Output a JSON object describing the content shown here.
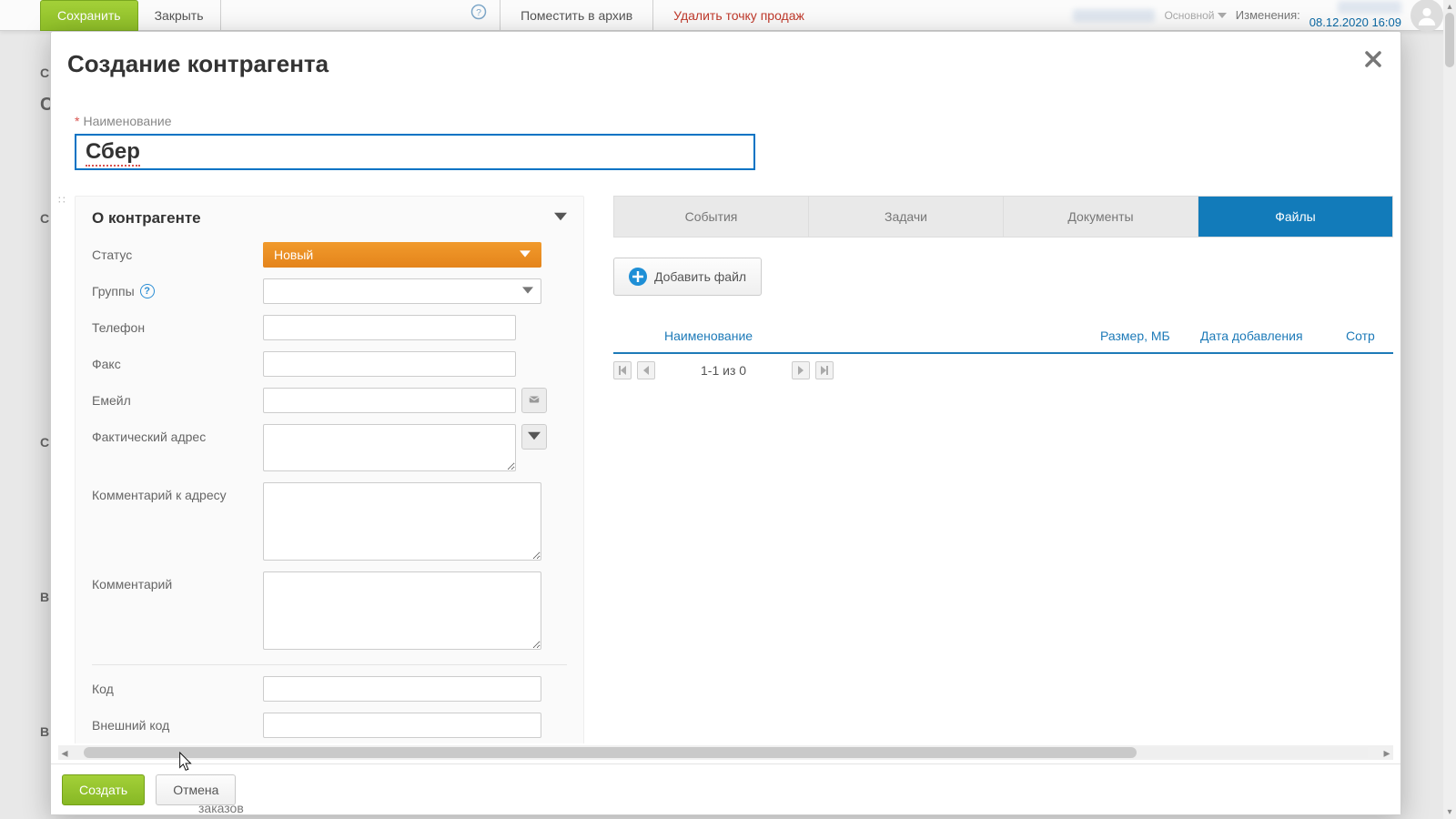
{
  "topbar": {
    "save": "Сохранить",
    "close": "Закрыть",
    "archive": "Поместить в архив",
    "delete": "Удалить точку продаж",
    "main": "Основной",
    "changes_label": "Изменения:",
    "date": "08.12.2020 16:09"
  },
  "bg_word": "заказов",
  "modal": {
    "title": "Создание контрагента",
    "name_label": "Наименование",
    "name_value": "Сбер",
    "panel_title": "О контрагенте",
    "fields": {
      "status_label": "Статус",
      "status_value": "Новый",
      "groups_label": "Группы",
      "phone_label": "Телефон",
      "fax_label": "Факс",
      "email_label": "Емейл",
      "address_label": "Фактический адрес",
      "addr_comment_label": "Комментарий к адресу",
      "comment_label": "Комментарий",
      "code_label": "Код",
      "extcode_label": "Внешний код"
    },
    "tabs": [
      "События",
      "Задачи",
      "Документы",
      "Файлы"
    ],
    "active_tab": 3,
    "add_file": "Добавить файл",
    "file_cols": [
      "Наименование",
      "Размер, МБ",
      "Дата добавления",
      "Сотр"
    ],
    "pager": "1-1 из 0",
    "create": "Создать",
    "cancel": "Отмена"
  }
}
